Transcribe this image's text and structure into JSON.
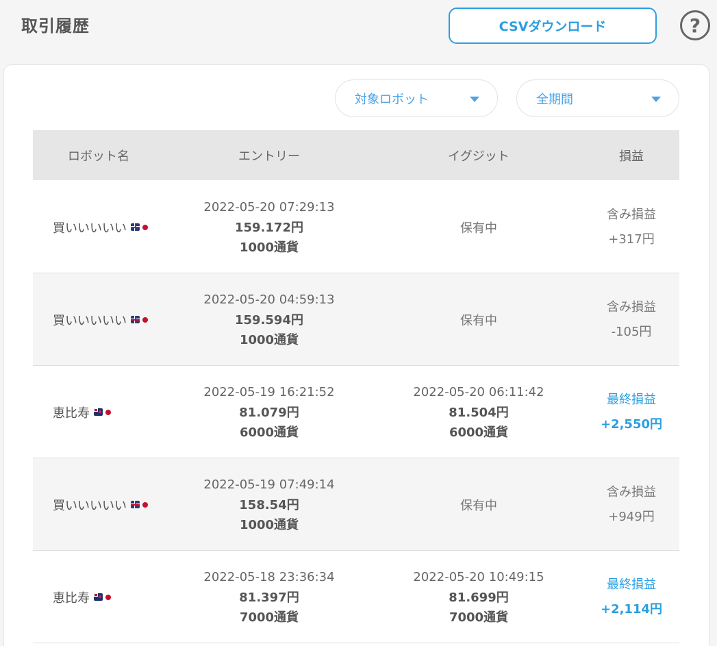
{
  "header": {
    "title": "取引履歴",
    "csv_button": "CSVダウンロード",
    "help_icon": "?"
  },
  "filters": {
    "robot": "対象ロボット",
    "period": "全期間"
  },
  "table": {
    "columns": [
      "ロボット名",
      "エントリー",
      "イグジット",
      "損益"
    ],
    "rows": [
      {
        "robot": "買いいいいい",
        "flag": "gb-icon",
        "entry_time": "2022-05-20 07:29:13",
        "entry_price": "159.172円",
        "entry_qty": "1000通貨",
        "exit_status": "保有中",
        "pl_label": "含み損益",
        "pl_value": "+317円",
        "final": false
      },
      {
        "robot": "買いいいいい",
        "flag": "gb-icon",
        "entry_time": "2022-05-20 04:59:13",
        "entry_price": "159.594円",
        "entry_qty": "1000通貨",
        "exit_status": "保有中",
        "pl_label": "含み損益",
        "pl_value": "-105円",
        "final": false
      },
      {
        "robot": "恵比寿",
        "flag": "nz-icon",
        "entry_time": "2022-05-19 16:21:52",
        "entry_price": "81.079円",
        "entry_qty": "6000通貨",
        "exit_time": "2022-05-20 06:11:42",
        "exit_price": "81.504円",
        "exit_qty": "6000通貨",
        "pl_label": "最終損益",
        "pl_value": "+2,550円",
        "final": true
      },
      {
        "robot": "買いいいいい",
        "flag": "gb-icon",
        "entry_time": "2022-05-19 07:49:14",
        "entry_price": "158.54円",
        "entry_qty": "1000通貨",
        "exit_status": "保有中",
        "pl_label": "含み損益",
        "pl_value": "+949円",
        "final": false
      },
      {
        "robot": "恵比寿",
        "flag": "nz-icon",
        "entry_time": "2022-05-18 23:36:34",
        "entry_price": "81.397円",
        "entry_qty": "7000通貨",
        "exit_time": "2022-05-20 10:49:15",
        "exit_price": "81.699円",
        "exit_qty": "7000通貨",
        "pl_label": "最終損益",
        "pl_value": "+2,114円",
        "final": true
      }
    ]
  },
  "colors": {
    "accent": "#2a9fe0",
    "header_bg": "#e6e6e6",
    "page_bg": "#f5f5f5"
  }
}
